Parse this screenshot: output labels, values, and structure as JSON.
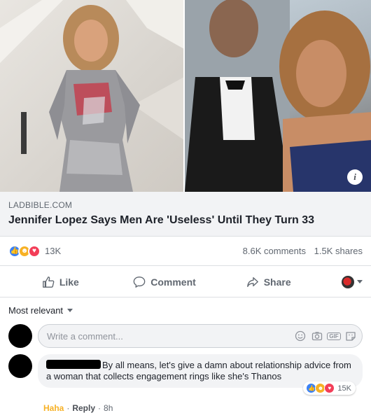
{
  "post": {
    "link": {
      "source": "LADBIBLE.COM",
      "title": "Jennifer Lopez Says Men Are 'Useless' Until They Turn 33"
    },
    "stats": {
      "reactions_count": "13K",
      "comments": "8.6K comments",
      "shares": "1.5K shares"
    },
    "actions": {
      "like": "Like",
      "comment": "Comment",
      "share": "Share"
    }
  },
  "comments": {
    "sort_label": "Most relevant",
    "composer_placeholder": "Write a comment...",
    "items": [
      {
        "text": "By all means, let's give a damn about relationship advice from a woman that collects engagement rings like she's Thanos",
        "reaction_count": "15K",
        "reaction_label": "Haha",
        "reply_label": "Reply",
        "time": "8h"
      }
    ]
  },
  "colors": {
    "like": "#3b82f6",
    "haha": "#f7b125",
    "love": "#f33e58",
    "text_secondary": "#606770"
  },
  "icons": [
    "info-icon",
    "like-reaction-icon",
    "haha-reaction-icon",
    "love-reaction-icon",
    "thumbs-up-icon",
    "comment-icon",
    "share-icon",
    "emoji-icon",
    "camera-icon",
    "gif-icon",
    "sticker-icon"
  ]
}
